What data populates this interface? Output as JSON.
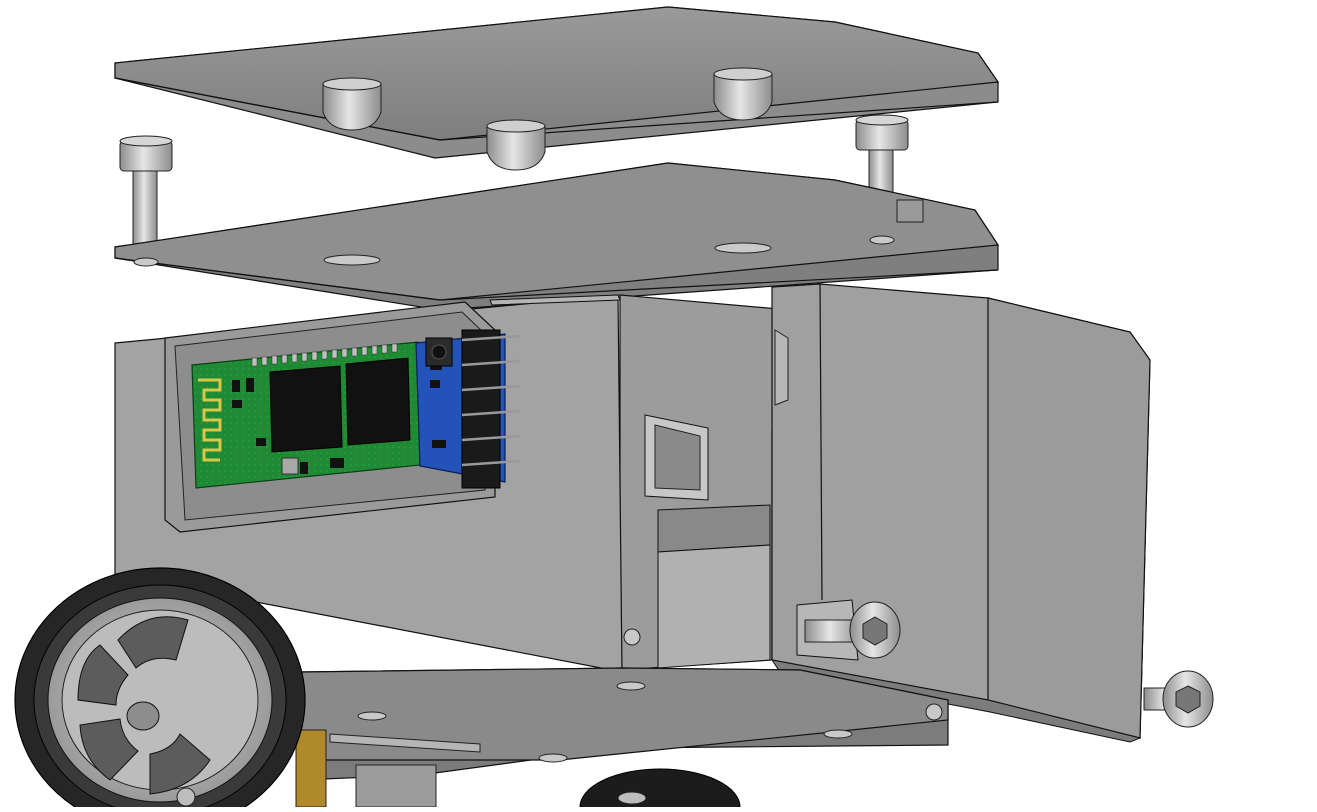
{
  "viewport": {
    "corner_text": "",
    "background_color": "#ffffff"
  },
  "model": {
    "description_name": "robot-chassis-exploded-assembly",
    "parts": [
      {
        "name": "top-cover-plate",
        "color": "#8f8f8f"
      },
      {
        "name": "middle-mount-plate",
        "color": "#8a8a8a"
      },
      {
        "name": "main-housing",
        "color": "#9a9a9a"
      },
      {
        "name": "bluetooth-module",
        "color": "#1e8c32"
      },
      {
        "name": "side-door-panel",
        "color": "#9c9c9c"
      },
      {
        "name": "left-wheel",
        "color": "#2b2b2b"
      },
      {
        "name": "socket-head-screws",
        "color": "#bdbdbd"
      }
    ]
  }
}
